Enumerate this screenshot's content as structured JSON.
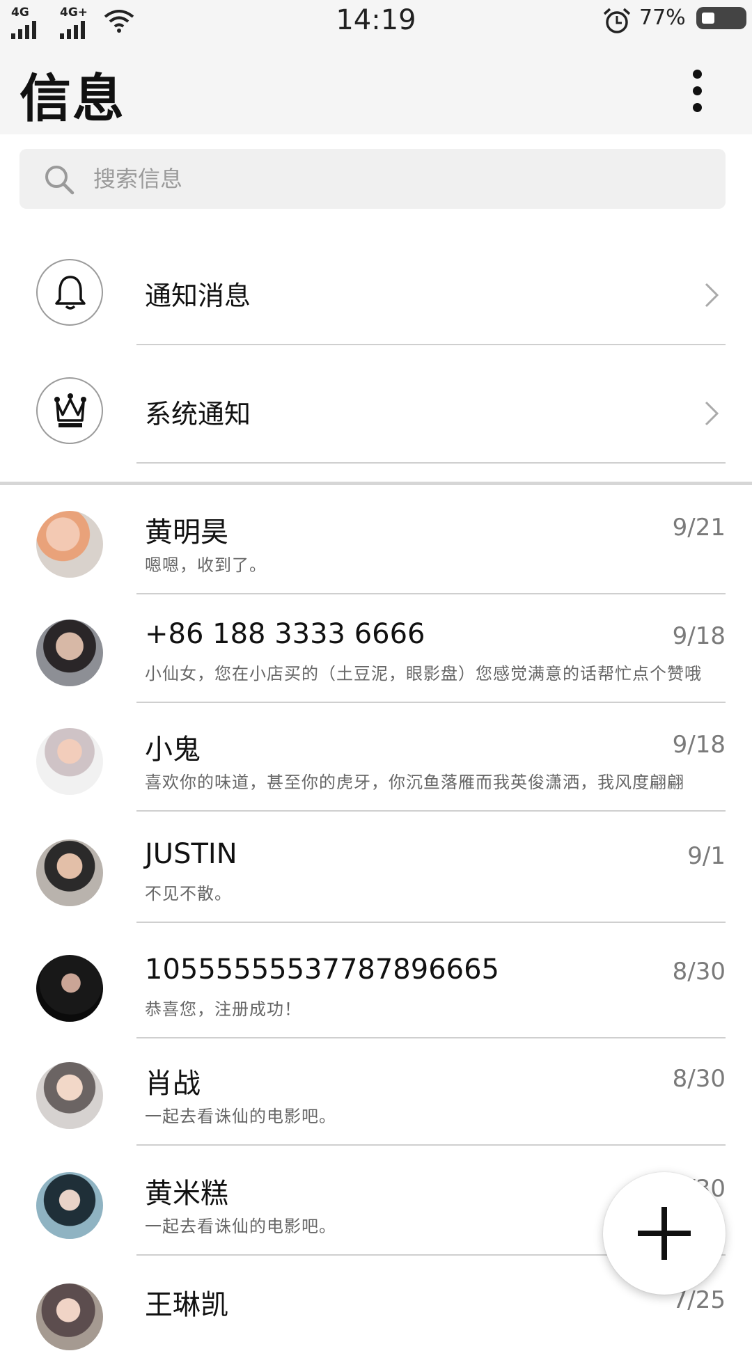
{
  "status_bar": {
    "signal1_label": "4G",
    "signal2_label": "4G+",
    "time": "14:19",
    "battery_percent": "77%",
    "icons": [
      "signal-icon",
      "wifi-icon",
      "alarm-icon",
      "battery-icon"
    ]
  },
  "header": {
    "title": "信息",
    "more_icon": "more-vertical-icon"
  },
  "search": {
    "placeholder": "搜索信息",
    "value": ""
  },
  "system_items": [
    {
      "label": "通知消息",
      "icon": "bell-icon"
    },
    {
      "label": "系统通知",
      "icon": "crown-icon"
    }
  ],
  "conversations": [
    {
      "name": "黄明昊",
      "date": "9/21",
      "preview": "嗯嗯，收到了。"
    },
    {
      "name": "+86 188 3333 6666",
      "date": "9/18",
      "preview": "小仙女，您在小店买的（土豆泥，眼影盘）您感觉满意的话帮忙点个赞哦"
    },
    {
      "name": "小鬼",
      "date": "9/18",
      "preview": "喜欢你的味道，甚至你的虎牙，你沉鱼落雁而我英俊潇洒，我风度翩翩"
    },
    {
      "name": "JUSTIN",
      "date": "9/1",
      "preview": "不见不散。"
    },
    {
      "name": "10555555537787896665",
      "date": "8/30",
      "preview": "恭喜您，注册成功！"
    },
    {
      "name": "肖战",
      "date": "8/30",
      "preview": "一起去看诛仙的电影吧。"
    },
    {
      "name": "黄米糕",
      "date": "8/30",
      "preview": "一起去看诛仙的电影吧。"
    },
    {
      "name": "王琳凯",
      "date": "7/25",
      "preview": ""
    }
  ],
  "fab": {
    "icon": "plus-icon"
  }
}
